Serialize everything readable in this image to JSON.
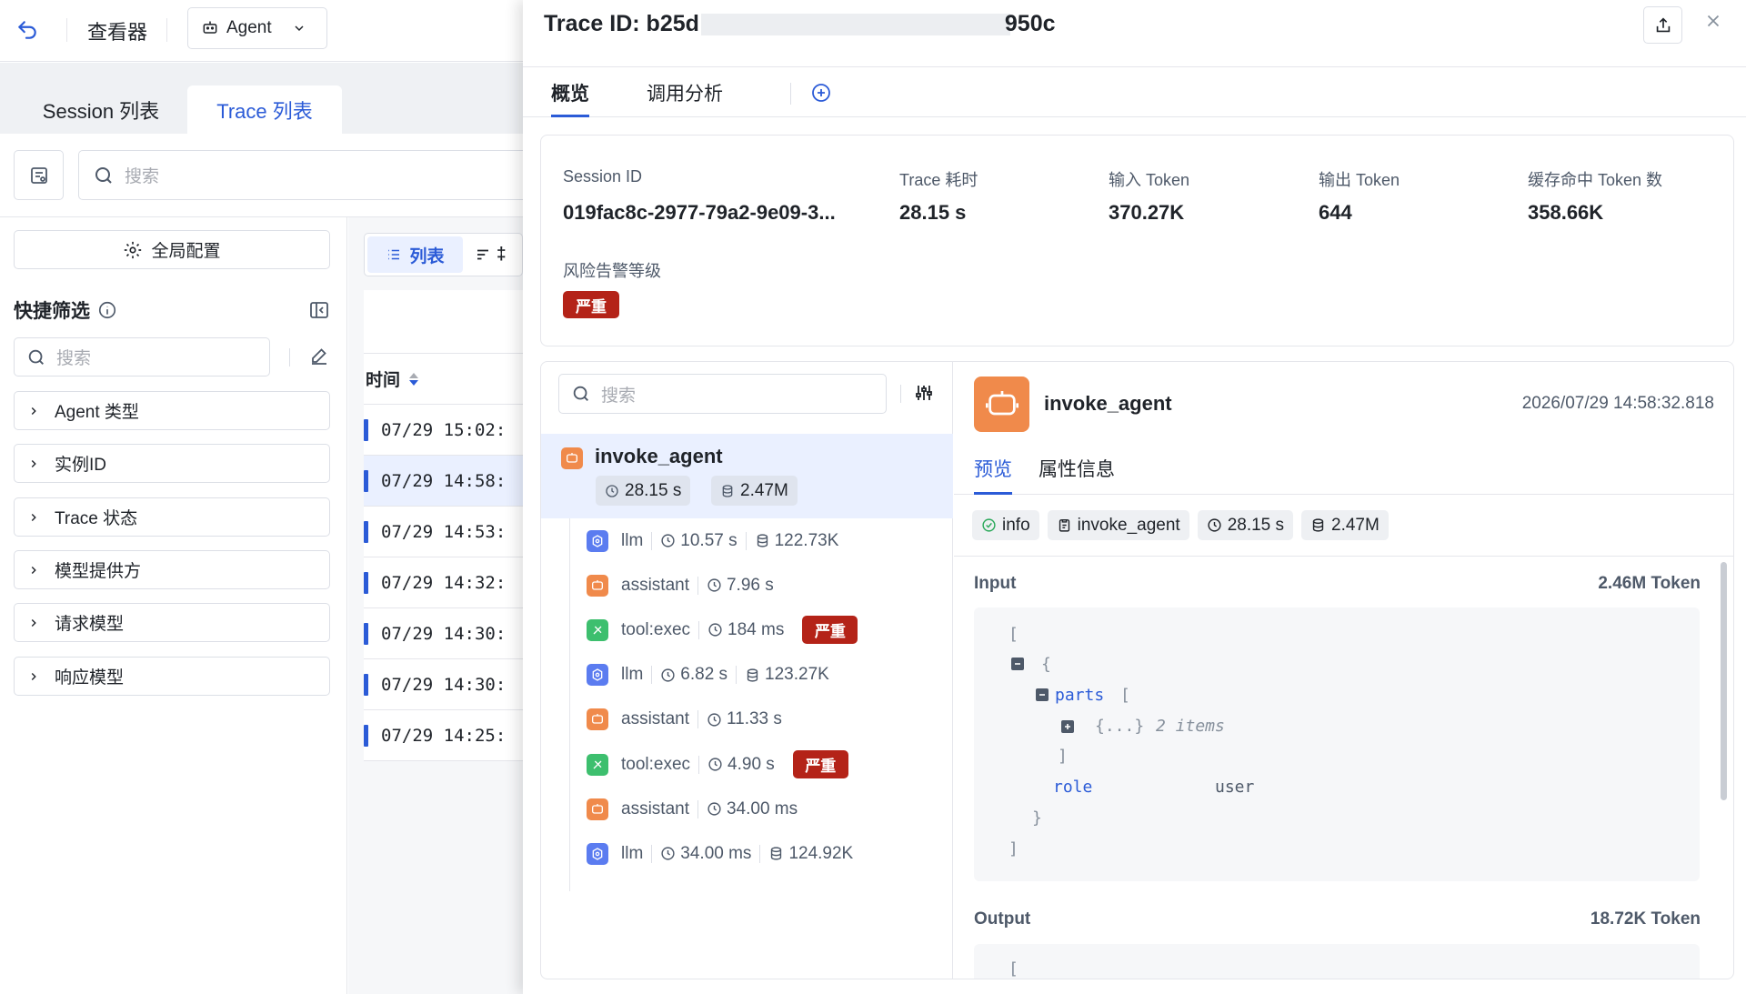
{
  "topbar": {
    "viewer_label": "查看器",
    "agent_select_value": "Agent"
  },
  "tabs": [
    {
      "label": "Session 列表"
    },
    {
      "label": "Trace 列表"
    }
  ],
  "search": {
    "placeholder": "搜索"
  },
  "sidebar": {
    "global_config_label": "全局配置",
    "quick_filter_title": "快捷筛选",
    "filter_search_placeholder": "搜索",
    "filters": [
      {
        "label": "Agent 类型"
      },
      {
        "label": "实例ID"
      },
      {
        "label": "Trace 状态"
      },
      {
        "label": "模型提供方"
      },
      {
        "label": "请求模型"
      },
      {
        "label": "响应模型"
      }
    ]
  },
  "list": {
    "view_list_label": "列表",
    "view_other_label": "‡",
    "time_header": "时间",
    "rows": [
      {
        "time": "07/29 15:02:"
      },
      {
        "time": "07/29 14:58:"
      },
      {
        "time": "07/29 14:53:"
      },
      {
        "time": "07/29 14:32:"
      },
      {
        "time": "07/29 14:30:"
      },
      {
        "time": "07/29 14:30:"
      },
      {
        "time": "07/29 14:25:"
      }
    ],
    "selected_row_index": 1
  },
  "panel": {
    "title_prefix": "Trace ID: b25d",
    "title_suffix": "950c",
    "tabs": [
      {
        "label": "概览"
      },
      {
        "label": "调用分析"
      }
    ],
    "summary": {
      "session_id_label": "Session ID",
      "session_id_value": "019fac8c-2977-79a2-9e09-3...",
      "trace_duration_label": "Trace 耗时",
      "trace_duration_value": "28.15 s",
      "input_token_label": "输入 Token",
      "input_token_value": "370.27K",
      "output_token_label": "输出 Token",
      "output_token_value": "644",
      "cache_hit_label": "缓存命中 Token 数",
      "cache_hit_value": "358.66K",
      "risk_label": "风险告警等级",
      "risk_value": "严重"
    },
    "tree": {
      "search_placeholder": "搜索",
      "root": {
        "name": "invoke_agent",
        "duration": "28.15 s",
        "tokens": "2.47M"
      },
      "children": [
        {
          "kind": "llm",
          "name": "llm",
          "duration": "10.57 s",
          "tokens": "122.73K",
          "risk": ""
        },
        {
          "kind": "agent",
          "name": "assistant",
          "duration": "7.96 s",
          "tokens": "",
          "risk": ""
        },
        {
          "kind": "tool",
          "name": "tool:exec",
          "duration": "184 ms",
          "tokens": "",
          "risk": "严重"
        },
        {
          "kind": "llm",
          "name": "llm",
          "duration": "6.82 s",
          "tokens": "123.27K",
          "risk": ""
        },
        {
          "kind": "agent",
          "name": "assistant",
          "duration": "11.33 s",
          "tokens": "",
          "risk": ""
        },
        {
          "kind": "tool",
          "name": "tool:exec",
          "duration": "4.90 s",
          "tokens": "",
          "risk": "严重"
        },
        {
          "kind": "agent",
          "name": "assistant",
          "duration": "34.00 ms",
          "tokens": "",
          "risk": ""
        },
        {
          "kind": "llm",
          "name": "llm",
          "duration": "34.00 ms",
          "tokens": "124.92K",
          "risk": ""
        }
      ]
    },
    "detail": {
      "name": "invoke_agent",
      "timestamp": "2026/07/29 14:58:32.818",
      "tabs": [
        {
          "label": "预览"
        },
        {
          "label": "属性信息"
        }
      ],
      "chips": {
        "level": "info",
        "span": "invoke_agent",
        "duration": "28.15 s",
        "tokens": "2.47M"
      },
      "input_label": "Input",
      "input_tokens": "2.46M Token",
      "json": {
        "open_bracket": "[",
        "open_brace": "{",
        "parts_key": "parts",
        "parts_bracket": "[",
        "collapsed": "{...}",
        "collapsed_count": "2 items",
        "close_parts": "]",
        "role_key": "role",
        "role_value": "user",
        "close_brace": "}",
        "close_bracket": "]"
      },
      "output_label": "Output",
      "output_tokens": "18.72K Token",
      "output_open": "["
    }
  },
  "colors": {
    "accent": "#2b5bd7",
    "danger": "#b42318",
    "agent_icon": "#f08a4b",
    "llm_icon": "#5b7cf0",
    "tool_icon": "#3dbf6e"
  }
}
